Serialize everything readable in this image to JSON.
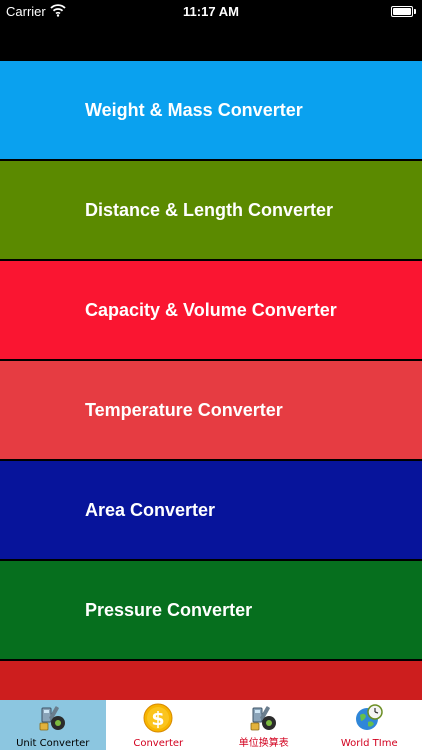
{
  "status_bar": {
    "carrier": "Carrier",
    "time": "11:17 AM",
    "wifi_icon": "wifi-icon",
    "battery_icon": "battery-icon"
  },
  "list": {
    "items": [
      {
        "label": "Weight & Mass Converter",
        "color": "#0aa1ef"
      },
      {
        "label": "Distance & Length Converter",
        "color": "#5b8a00"
      },
      {
        "label": "Capacity & Volume Converter",
        "color": "#fa1531"
      },
      {
        "label": "Temperature Converter",
        "color": "#e63c42"
      },
      {
        "label": "Area Converter",
        "color": "#07149b"
      },
      {
        "label": "Pressure Converter",
        "color": "#066f1e"
      },
      {
        "label": "",
        "color": "#cd1e1e"
      }
    ]
  },
  "tab_bar": {
    "tabs": [
      {
        "label": "Unit Converter",
        "icon": "tools-icon",
        "active": true
      },
      {
        "label": "Converter",
        "icon": "dollar-coin-icon",
        "active": false
      },
      {
        "label": "单位换算表",
        "icon": "tools-icon",
        "active": false
      },
      {
        "label": "World TIme",
        "icon": "globe-clock-icon",
        "active": false
      }
    ],
    "active_bg": "#8cc6e0",
    "label_color": "#d2001e"
  }
}
